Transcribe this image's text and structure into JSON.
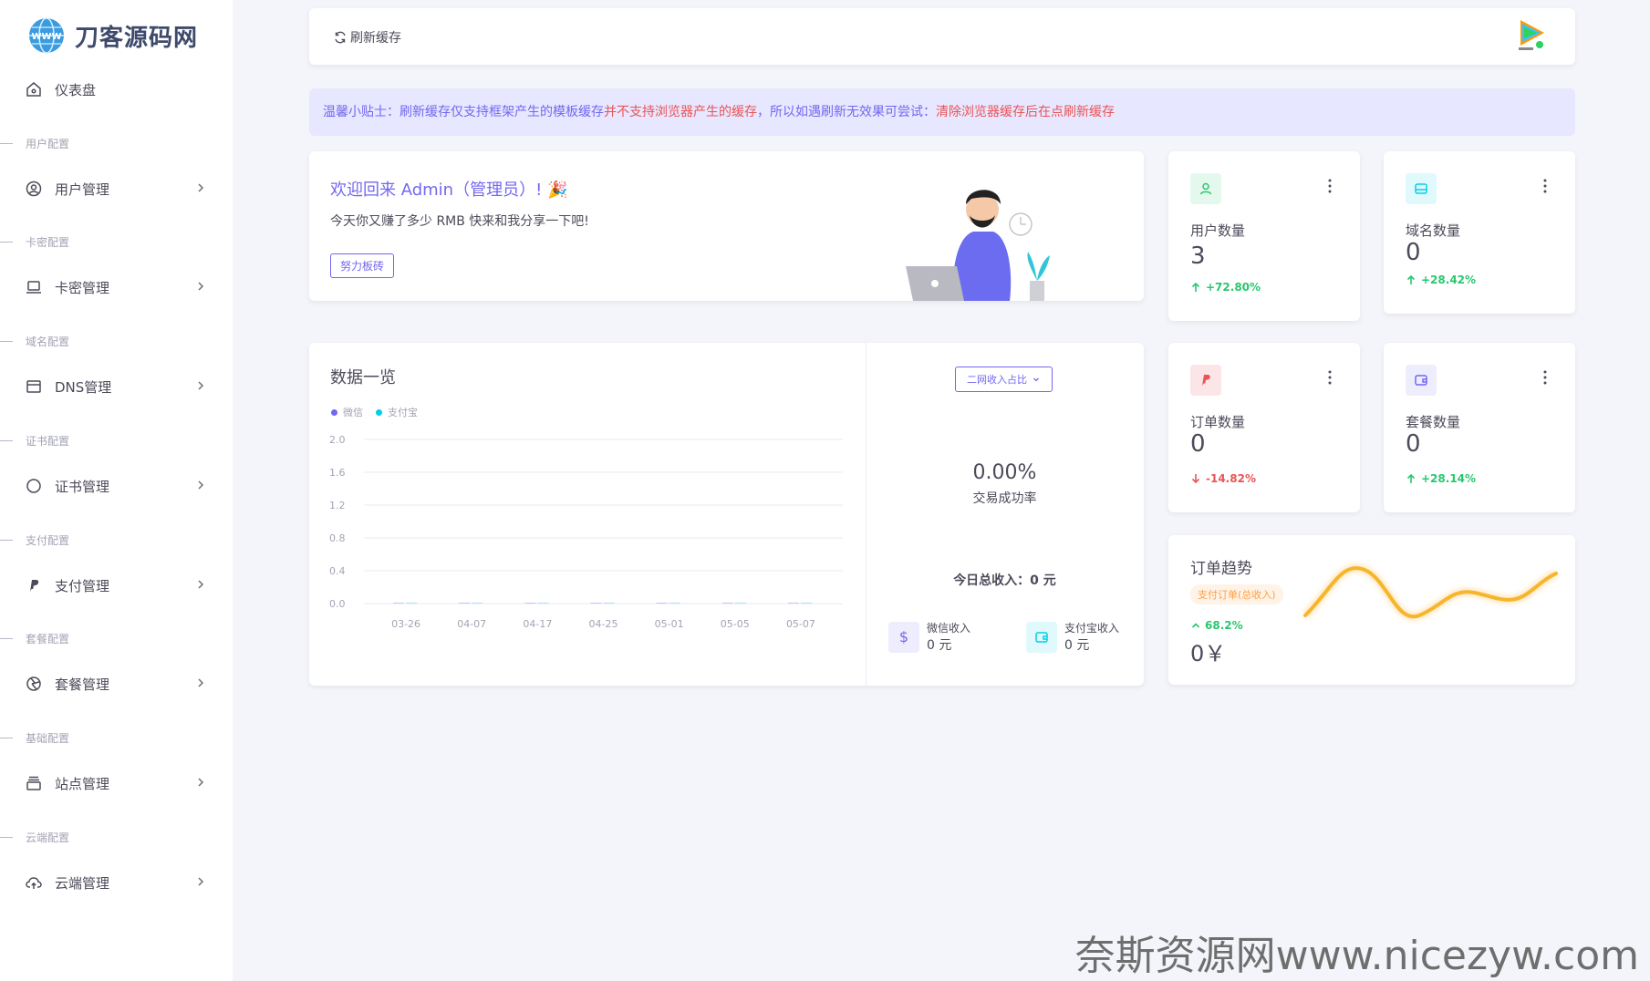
{
  "brand": {
    "name": "刀客源码网"
  },
  "sidebar": {
    "dashboard": "仪表盘",
    "sections": [
      {
        "label": "用户配置",
        "item": "用户管理",
        "icon": "user-circle-icon"
      },
      {
        "label": "卡密配置",
        "item": "卡密管理",
        "icon": "laptop-icon"
      },
      {
        "label": "域名配置",
        "item": "DNS管理",
        "icon": "browser-window-icon"
      },
      {
        "label": "证书配置",
        "item": "证书管理",
        "icon": "circle-outline-icon"
      },
      {
        "label": "支付配置",
        "item": "支付管理",
        "icon": "paypal-icon"
      },
      {
        "label": "套餐配置",
        "item": "套餐管理",
        "icon": "aperture-icon"
      },
      {
        "label": "基础配置",
        "item": "站点管理",
        "icon": "archive-icon"
      },
      {
        "label": "云端配置",
        "item": "云端管理",
        "icon": "cloud-upload-icon"
      }
    ]
  },
  "topbar": {
    "refresh_label": "刷新缓存"
  },
  "tip": {
    "part1": "温馨小贴士：刷新缓存仅支持框架产生的模板缓存",
    "part2": "并不支持浏览器产生的缓存",
    "part3": "，所以如遇刷新无效果可尝试：",
    "part4": "清除浏览器缓存后在点刷新缓存"
  },
  "welcome": {
    "title": "欢迎回来 Admin（管理员）!",
    "subtitle": "今天你又赚了多少 RMB 快来和我分享一下吧!",
    "button": "努力板砖"
  },
  "stats": [
    {
      "label": "用户数量",
      "value": "3",
      "trend": "+72.80%",
      "direction": "up",
      "color": "#28c76f",
      "bg": "#e5f8ed"
    },
    {
      "label": "域名数量",
      "value": "0",
      "trend": "+28.42%",
      "direction": "up",
      "color": "#00cfe8",
      "bg": "#e0f9fc"
    },
    {
      "label": "订单数量",
      "value": "0",
      "trend": "-14.82%",
      "direction": "down",
      "color": "#ea5455",
      "bg": "#fce5e6"
    },
    {
      "label": "套餐数量",
      "value": "0",
      "trend": "+28.14%",
      "direction": "up",
      "color": "#7367f0",
      "bg": "#eeedfd"
    }
  ],
  "overview": {
    "title": "数据一览",
    "legend": [
      {
        "name": "微信",
        "color": "#7367f0"
      },
      {
        "name": "支付宝",
        "color": "#00cfe8"
      }
    ],
    "select_label": "二网收入占比",
    "success_rate": "0.00%",
    "success_label": "交易成功率",
    "total_today": "今日总收入：0 元",
    "wechat": {
      "label": "微信收入",
      "value": "0 元"
    },
    "alipay": {
      "label": "支付宝收入",
      "value": "0 元"
    }
  },
  "chart_data": {
    "type": "bar",
    "categories": [
      "03-26",
      "04-07",
      "04-17",
      "04-25",
      "05-01",
      "05-05",
      "05-07"
    ],
    "series": [
      {
        "name": "微信",
        "values": [
          0,
          0,
          0,
          0,
          0,
          0,
          0
        ]
      },
      {
        "name": "支付宝",
        "values": [
          0,
          0,
          0,
          0,
          0,
          0,
          0
        ]
      }
    ],
    "yticks": [
      "0.0",
      "0.4",
      "0.8",
      "1.2",
      "1.6",
      "2.0"
    ],
    "ylim": [
      0,
      2.0
    ]
  },
  "trend": {
    "title": "订单趋势",
    "badge": "支付订单(总收入)",
    "percent": "68.2%",
    "amount": "0￥"
  },
  "watermark": "奈斯资源网www.nicezyw.com"
}
